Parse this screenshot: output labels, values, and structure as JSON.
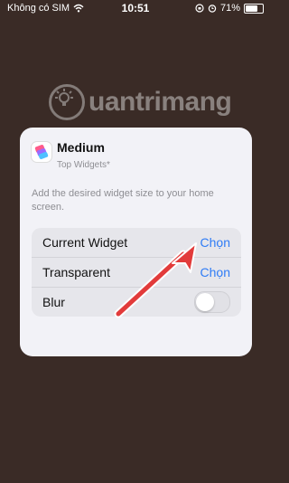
{
  "status_bar": {
    "carrier": "Không có SIM",
    "time": "10:51",
    "battery": "71%",
    "battery_level": 0.71
  },
  "watermark": {
    "text": "uantrimang"
  },
  "card": {
    "app_icon": "shortcut-stack-icon",
    "title": "Medium",
    "subtitle": "Top Widgets*",
    "description": "Add the desired widget size to your home screen.",
    "rows": [
      {
        "label": "Current Widget",
        "action": "Chọn"
      },
      {
        "label": "Transparent",
        "action": "Chọn"
      },
      {
        "label": "Blur",
        "toggle_on": false
      }
    ]
  },
  "annotation": {
    "arrow_color": "#e23b3b"
  },
  "colors": {
    "background": "#3a2b26",
    "card": "#f2f2f7",
    "accent": "#2f7cf6"
  }
}
